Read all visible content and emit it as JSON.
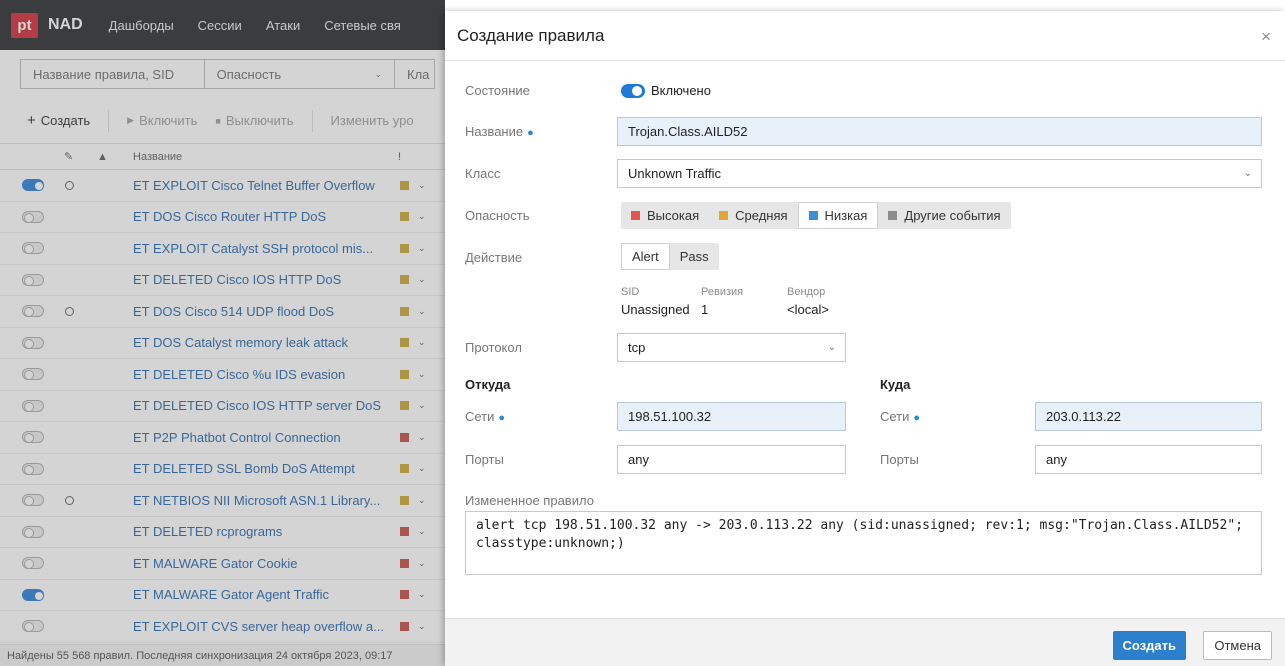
{
  "app": {
    "logo": "pt",
    "product": "NAD",
    "nav": [
      "Дашборды",
      "Сессии",
      "Атаки",
      "Сетевые свя"
    ],
    "filters": {
      "sid_placeholder": "Название правила, SID",
      "danger_placeholder": "Опасность",
      "class_placeholder": "Кла"
    },
    "toolbar": {
      "create": "Создать",
      "enable": "Включить",
      "disable": "Выключить",
      "change": "Изменить уро"
    },
    "table_header": {
      "name": "Название",
      "sev": "!"
    },
    "rows": [
      {
        "name": "ET EXPLOIT Cisco Telnet Buffer Overflow",
        "on": true,
        "circle": true,
        "sev": "#c9a22a"
      },
      {
        "name": "ET DOS Cisco Router HTTP DoS",
        "on": false,
        "circle": false,
        "sev": "#c9a22a"
      },
      {
        "name": "ET EXPLOIT Catalyst SSH protocol mis...",
        "on": false,
        "circle": false,
        "sev": "#c9a22a"
      },
      {
        "name": "ET DELETED Cisco IOS HTTP DoS",
        "on": false,
        "circle": false,
        "sev": "#c9a22a"
      },
      {
        "name": "ET DOS Cisco 514 UDP flood DoS",
        "on": false,
        "circle": true,
        "sev": "#c9a22a"
      },
      {
        "name": "ET DOS Catalyst memory leak attack",
        "on": false,
        "circle": false,
        "sev": "#c9a22a"
      },
      {
        "name": "ET DELETED Cisco %u IDS evasion",
        "on": false,
        "circle": false,
        "sev": "#c9a22a"
      },
      {
        "name": "ET DELETED Cisco IOS HTTP server DoS",
        "on": false,
        "circle": false,
        "sev": "#c9a22a"
      },
      {
        "name": "ET P2P Phatbot Control Connection",
        "on": false,
        "circle": false,
        "sev": "#c0473a"
      },
      {
        "name": "ET DELETED SSL Bomb DoS Attempt",
        "on": false,
        "circle": false,
        "sev": "#c9a22a"
      },
      {
        "name": "ET NETBIOS NII Microsoft ASN.1 Library...",
        "on": false,
        "circle": true,
        "sev": "#c9a22a"
      },
      {
        "name": "ET DELETED rcprograms",
        "on": false,
        "circle": false,
        "sev": "#c0473a"
      },
      {
        "name": "ET MALWARE Gator Cookie",
        "on": false,
        "circle": false,
        "sev": "#c0473a"
      },
      {
        "name": "ET MALWARE Gator Agent Traffic",
        "on": true,
        "circle": false,
        "sev": "#c0473a"
      },
      {
        "name": "ET EXPLOIT CVS server heap overflow a...",
        "on": false,
        "circle": false,
        "sev": "#c0473a"
      }
    ],
    "status": "Найдены 55 568 правил. Последняя синхронизация 24 октября 2023, 09:17"
  },
  "dialog": {
    "title": "Создание правила",
    "close": "×",
    "state_label": "Состояние",
    "state_value": "Включено",
    "name_label": "Название",
    "name_value": "Trojan.Class.AILD52",
    "class_label": "Класс",
    "class_value": "Unknown Traffic",
    "danger_label": "Опасность",
    "danger_options": [
      {
        "label": "Высокая",
        "color": "#e2574c"
      },
      {
        "label": "Средняя",
        "color": "#e0a833"
      },
      {
        "label": "Низкая",
        "color": "#3b8fd6"
      },
      {
        "label": "Другие события",
        "color": "#8c8c8c"
      }
    ],
    "danger_selected_index": 2,
    "action_label": "Действие",
    "action_options": [
      "Alert",
      "Pass"
    ],
    "sid_label": "SID",
    "sid_value": "Unassigned",
    "rev_label": "Ревизия",
    "rev_value": "1",
    "vendor_label": "Вендор",
    "vendor_value": "<local>",
    "protocol_label": "Протокол",
    "protocol_value": "tcp",
    "from_heading": "Откуда",
    "to_heading": "Куда",
    "nets_label": "Сети",
    "ports_label": "Порты",
    "from_nets": "198.51.100.32",
    "from_ports": "any",
    "to_nets": "203.0.113.22",
    "to_ports": "any",
    "rule_label": "Измененное правило",
    "rule_text_line1": "alert tcp 198.51.100.32 any -> 203.0.113.22 any (sid:unassigned; rev:1; msg:\"Trojan.Class.AILD52\";",
    "rule_text_line2": "classtype:unknown;)",
    "create_button": "Создать",
    "cancel_button": "Отмена"
  }
}
